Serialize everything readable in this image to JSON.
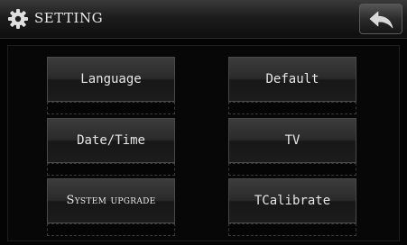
{
  "header": {
    "title": "SETTING",
    "icon": "gear-icon",
    "back_icon": "back-arrow-icon"
  },
  "menu": {
    "language": "Language",
    "default": "Default",
    "date_time": "Date/Time",
    "tv": "TV",
    "system_upgrade": "System upgrade",
    "tcalibrate": "TCalibrate"
  },
  "colors": {
    "background": "#040404",
    "button_top": "#3c3c3c",
    "button_bottom": "#171717",
    "text": "#e6e6e6"
  }
}
